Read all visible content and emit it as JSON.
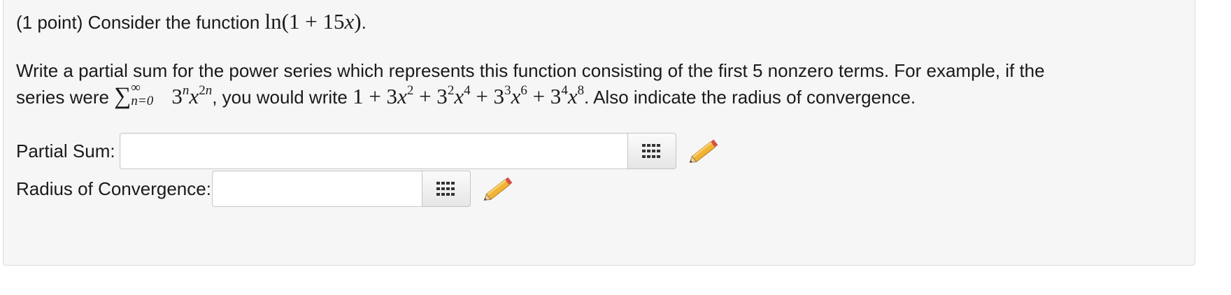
{
  "question": {
    "points": "(1 point) Consider the function",
    "function": "ln(1 + 15x)",
    "period": ".",
    "instruction_1": "Write a partial sum for the power series which represents this function consisting of the first 5 nonzero terms. For example, if the",
    "series_were": "series were",
    "sum_upper": "∞",
    "sum_lower": "n=0",
    "example_series": "3",
    "you_would_write": ", you would write",
    "also": ". Also indicate the radius of convergence."
  },
  "fields": [
    {
      "label": "Partial Sum:",
      "value": "",
      "placeholder": ""
    },
    {
      "label": "Radius of Convergence:",
      "value": "",
      "placeholder": ""
    }
  ],
  "icons": {
    "palette": "keypad-grid-icon",
    "edit": "pencil-icon"
  },
  "colors": {
    "panel_bg": "#f6f6f6",
    "panel_border": "#dcdcdc",
    "pencil_body": "#f2b233",
    "pencil_tip": "#d94f4f"
  }
}
